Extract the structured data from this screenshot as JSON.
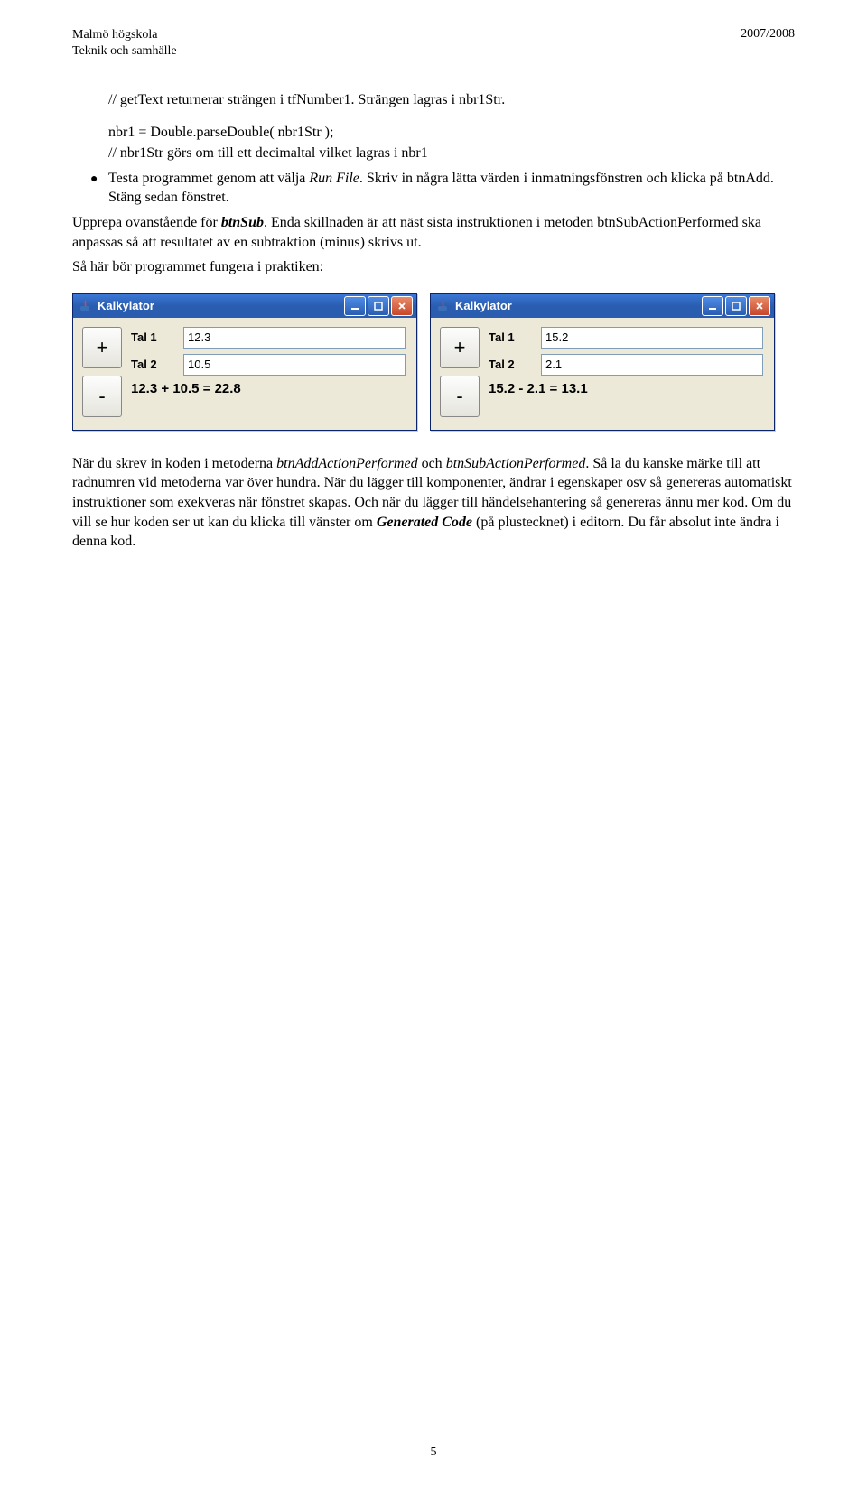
{
  "header": {
    "left_line1": "Malmö högskola",
    "left_line2": "Teknik och samhälle",
    "right": "2007/2008"
  },
  "code": {
    "comment1": "// getText returnerar strängen i tfNumber1. Strängen lagras i nbr1Str.",
    "line1": "nbr1 = Double.parseDouble( nbr1Str );",
    "comment2": "// nbr1Str görs om till ett decimaltal vilket lagras i nbr1"
  },
  "bullet": {
    "text_pre": "Testa programmet genom att välja ",
    "runfile": "Run File",
    "text_post": ". Skriv in några lätta värden i inmatningsfönstren och klicka på btnAdd. Stäng sedan fönstret."
  },
  "para1": {
    "pre": "Upprepa ovanstående för ",
    "btnsub": "btnSub",
    "post": ". Enda skillnaden är att näst sista instruktionen i metoden btnSubActionPerformed ska anpassas så att resultatet av en subtraktion (minus) skrivs ut."
  },
  "para2": "Så här bör programmet fungera i praktiken:",
  "windows": {
    "title": "Kalkylator",
    "tal1": "Tal 1",
    "tal2": "Tal 2",
    "plus": "+",
    "minus": "-",
    "w1": {
      "v1": "12.3",
      "v2": "10.5",
      "result": "12.3 + 10.5 = 22.8"
    },
    "w2": {
      "v1": "15.2",
      "v2": "2.1",
      "result": "15.2 - 2.1 = 13.1"
    }
  },
  "para3": {
    "t1": "När du skrev in koden i metoderna ",
    "m1": "btnAddActionPerformed",
    "t2": " och ",
    "m2": "btnSubActionPerformed",
    "t3": ". Så la du kanske märke till att radnumren vid metoderna var över hundra. När du lägger till komponenter, ändrar i egenskaper osv så genereras automatiskt instruktioner som exekveras när fönstret skapas. Och när du lägger till händelsehantering så genereras ännu mer kod. Om du vill se hur koden ser ut kan du klicka till vänster om ",
    "gc": "Generated Code",
    "t4": " (på plustecknet) i editorn. Du får absolut inte ändra i denna kod."
  },
  "pagenum": "5"
}
